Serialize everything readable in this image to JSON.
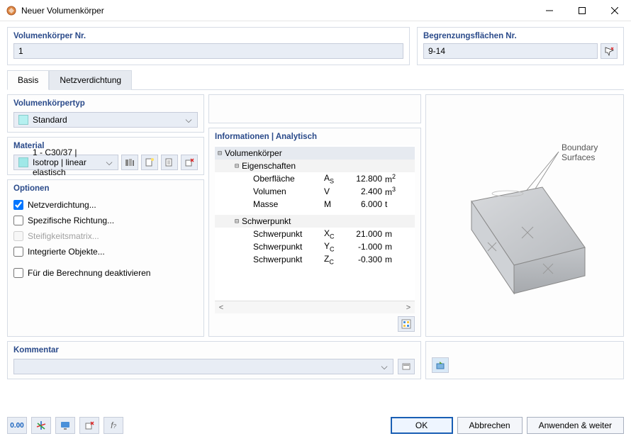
{
  "window": {
    "title": "Neuer Volumenkörper"
  },
  "top": {
    "nr_label": "Volumenkörper Nr.",
    "nr_value": "1",
    "surf_label": "Begrenzungsflächen Nr.",
    "surf_value": "9-14"
  },
  "tabs": {
    "basis": "Basis",
    "netz": "Netzverdichtung"
  },
  "type": {
    "label": "Volumenkörpertyp",
    "value": "Standard"
  },
  "material": {
    "label": "Material",
    "value": "1 - C30/37 | Isotrop | linear elastisch"
  },
  "options": {
    "label": "Optionen",
    "mesh": "Netzverdichtung...",
    "dir": "Spezifische Richtung...",
    "stiff": "Steifigkeitsmatrix...",
    "intobj": "Integrierte Objekte...",
    "deact": "Für die Berechnung deaktivieren"
  },
  "info": {
    "header": "Informationen | Analytisch",
    "root": "Volumenkörper",
    "eig": "Eigenschaften",
    "rows_eig": [
      {
        "lbl": "Oberfläche",
        "sym": "A",
        "sub": "S",
        "val": "12.800",
        "unit": "m",
        "sup": "2"
      },
      {
        "lbl": "Volumen",
        "sym": "V",
        "sub": "",
        "val": "2.400",
        "unit": "m",
        "sup": "3"
      },
      {
        "lbl": "Masse",
        "sym": "M",
        "sub": "",
        "val": "6.000",
        "unit": "t",
        "sup": ""
      }
    ],
    "sp": "Schwerpunkt",
    "rows_sp": [
      {
        "lbl": "Schwerpunkt",
        "sym": "X",
        "sub": "C",
        "val": "21.000",
        "unit": "m"
      },
      {
        "lbl": "Schwerpunkt",
        "sym": "Y",
        "sub": "C",
        "val": "-1.000",
        "unit": "m"
      },
      {
        "lbl": "Schwerpunkt",
        "sym": "Z",
        "sub": "C",
        "val": "-0.300",
        "unit": "m"
      }
    ]
  },
  "preview": {
    "label": "Boundary\nSurfaces"
  },
  "comment": {
    "label": "Kommentar",
    "value": ""
  },
  "buttons": {
    "ok": "OK",
    "cancel": "Abbrechen",
    "apply": "Anwenden & weiter"
  }
}
